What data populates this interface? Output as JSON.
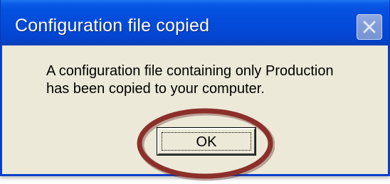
{
  "dialog": {
    "title": "Configuration file copied",
    "message_lines": [
      "A configuration file containing only Production",
      "has been copied to your computer."
    ],
    "ok_label": "OK"
  },
  "icons": {
    "close": "close-icon"
  },
  "colors": {
    "titlebar": "#0449d8",
    "dialog_background": "#ece9d8",
    "close_button": "#7f9bd8",
    "annotation_ring": "#8c2f2a"
  }
}
